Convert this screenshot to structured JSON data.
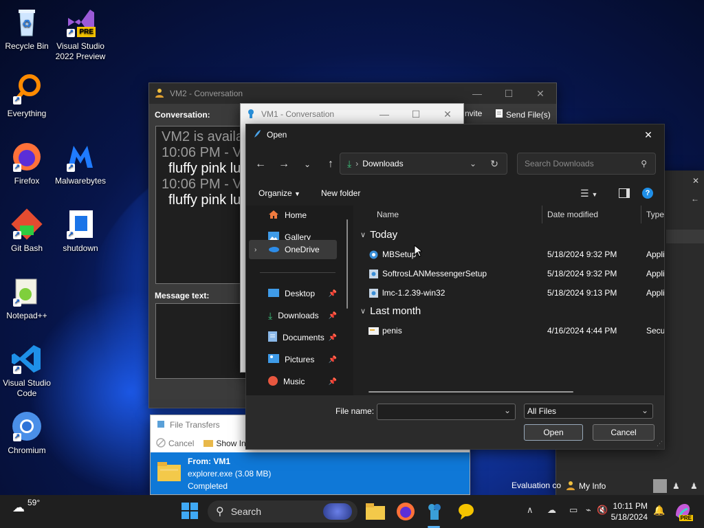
{
  "desktop": {
    "icons": [
      {
        "label": "Recycle Bin"
      },
      {
        "label": "Visual Studio 2022 Preview",
        "badge": "PRE"
      },
      {
        "label": "Everything"
      },
      {
        "label": "Firefox"
      },
      {
        "label": "Malwarebytes"
      },
      {
        "label": "Git Bash"
      },
      {
        "label": "shutdown"
      },
      {
        "label": "Notepad++"
      },
      {
        "label": "Visual Studio Code"
      },
      {
        "label": "Chromium"
      }
    ],
    "watermark": "Evaluation co"
  },
  "vm2": {
    "title": "VM2 - Conversation",
    "conversation_label": "Conversation:",
    "message_label": "Message text:",
    "invite_label": "nvite",
    "send_files_label": "Send File(s)",
    "lines": [
      {
        "text": "VM2 is availab",
        "style": "gray"
      },
      {
        "text": "10:06 PM - VM",
        "style": "gray"
      },
      {
        "text": "fluffy pink lu",
        "style": "white"
      },
      {
        "text": "10:06 PM - VM",
        "style": "gray"
      },
      {
        "text": "fluffy pink lu",
        "style": "white"
      }
    ]
  },
  "vm1": {
    "title": "VM1 - Conversation"
  },
  "file_transfers": {
    "title": "File Transfers",
    "cancel_label": "Cancel",
    "show_in_label": "Show In",
    "item": {
      "from": "From: VM1",
      "file": "explorer.exe (3.08 MB)",
      "status": "Completed"
    }
  },
  "open_dialog": {
    "title": "Open",
    "breadcrumb": "Downloads",
    "search_placeholder": "Search Downloads",
    "organize_label": "Organize",
    "new_folder_label": "New folder",
    "nav_items": [
      {
        "label": "Home",
        "pinned": false
      },
      {
        "label": "Gallery",
        "pinned": false
      },
      {
        "label": "OneDrive",
        "pinned": false,
        "selected": true
      },
      {
        "label": "Desktop",
        "pinned": true
      },
      {
        "label": "Downloads",
        "pinned": true
      },
      {
        "label": "Documents",
        "pinned": true
      },
      {
        "label": "Pictures",
        "pinned": true
      },
      {
        "label": "Music",
        "pinned": true
      }
    ],
    "columns": {
      "name": "Name",
      "date": "Date modified",
      "type": "Type"
    },
    "groups": [
      {
        "label": "Today",
        "files": [
          {
            "name": "MBSetup",
            "date": "5/18/2024 9:32 PM",
            "type": "Appli"
          },
          {
            "name": "SoftrosLANMessengerSetup",
            "date": "5/18/2024 9:32 PM",
            "type": "Appli"
          },
          {
            "name": "lmc-1.2.39-win32",
            "date": "5/18/2024 9:13 PM",
            "type": "Appli"
          }
        ]
      },
      {
        "label": "Last month",
        "files": [
          {
            "name": "penis",
            "date": "4/16/2024 4:44 PM",
            "type": "Secur"
          }
        ]
      }
    ],
    "file_name_label": "File name:",
    "file_name_value": "",
    "filter_value": "All Files",
    "open_label": "Open",
    "cancel_label": "Cancel"
  },
  "myinfo": {
    "label": "My Info"
  },
  "taskbar": {
    "weather": "59°",
    "search_label": "Search",
    "time": "10:11 PM",
    "date": "5/18/2024",
    "copilot_badge": "PRE"
  }
}
